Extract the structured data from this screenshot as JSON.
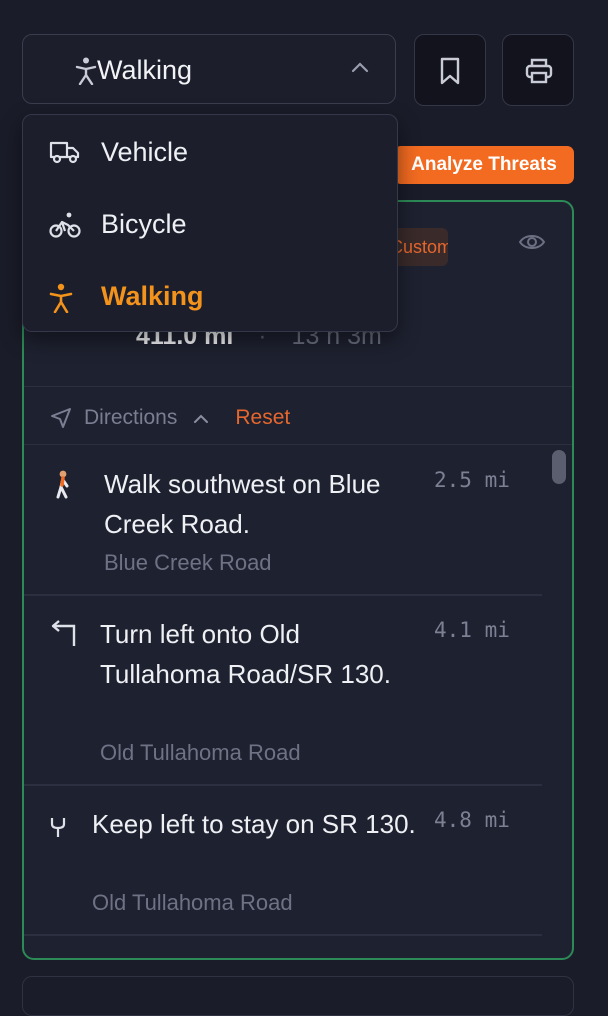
{
  "mode_select": {
    "value": "Walking",
    "open": true
  },
  "mode_options": [
    {
      "label": "Vehicle",
      "icon": "truck-icon"
    },
    {
      "label": "Bicycle",
      "icon": "bicycle-icon"
    },
    {
      "label": "Walking",
      "icon": "walking-icon",
      "selected": true
    }
  ],
  "toolbar": {
    "bookmark_icon": "bookmark-icon",
    "print_icon": "printer-icon"
  },
  "analyze_threats_label": "Analyze Threats",
  "route": {
    "badge": "Custom",
    "distance": "411.0 mi",
    "separator": "·",
    "duration": "13 h 3m",
    "directions_label": "Directions",
    "reset_label": "Reset",
    "steps": [
      {
        "icon": "walking-person-icon",
        "instruction": "Walk southwest on Blue Creek Road.",
        "road": "Blue Creek Road",
        "distance": "2.5 mi"
      },
      {
        "icon": "turn-left-icon",
        "instruction": "Turn left onto Old Tullahoma Road/SR 130.",
        "road": "Old Tullahoma Road",
        "distance": "4.1 mi"
      },
      {
        "icon": "keep-left-icon",
        "instruction": "Keep left to stay on SR 130.",
        "road": "Old Tullahoma Road",
        "distance": "4.8 mi"
      }
    ]
  },
  "colors": {
    "accent": "#f26b21",
    "selected": "#f3931b",
    "card_border": "#2c8a56",
    "background": "#1a1c29"
  }
}
